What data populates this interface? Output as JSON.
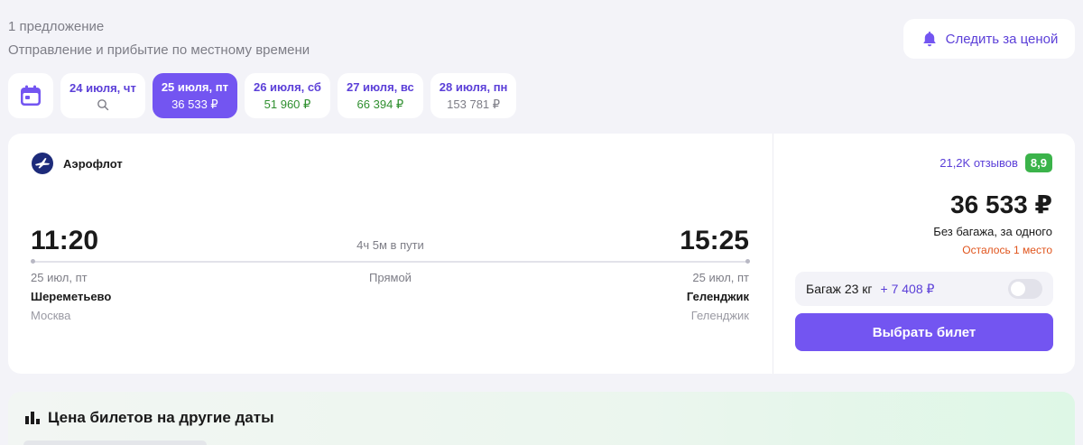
{
  "header": {
    "offers_count": "1 предложение",
    "time_note": "Отправление и прибытие по местному времени",
    "watch_price_label": "Следить за ценой"
  },
  "dates": [
    {
      "date": "24 июля, чт",
      "price": "",
      "icon": "search-icon",
      "state": "default"
    },
    {
      "date": "25 июля, пт",
      "price": "36 533 ₽",
      "state": "active"
    },
    {
      "date": "26 июля, сб",
      "price": "51 960 ₽",
      "state": "green"
    },
    {
      "date": "27 июля, вс",
      "price": "66 394 ₽",
      "state": "green"
    },
    {
      "date": "28 июля, пн",
      "price": "153 781 ₽",
      "state": "gray"
    }
  ],
  "flight": {
    "airline": "Аэрофлот",
    "departure": {
      "time": "11:20",
      "date": "25 июл, пт",
      "airport": "Шереметьево",
      "city": "Москва"
    },
    "arrival": {
      "time": "15:25",
      "date": "25 июл, пт",
      "airport": "Геленджик",
      "city": "Геленджик"
    },
    "duration": "4ч 5м в пути",
    "route_type": "Прямой"
  },
  "offer": {
    "reviews": "21,2K отзывов",
    "rating": "8,9",
    "price": "36 533 ₽",
    "price_note": "Без багажа, за одного",
    "seats_left": "Осталось 1 место",
    "baggage_label": "Багаж 23 кг",
    "baggage_price": "+ 7 408 ₽",
    "baggage_toggle_on": false,
    "select_label": "Выбрать билет"
  },
  "other_dates": {
    "title": "Цена билетов на другие даты"
  },
  "colors": {
    "accent": "#7355f1",
    "accent_text": "#5b3fd8",
    "rating_bg": "#3bb34a",
    "warning": "#e0541c"
  }
}
